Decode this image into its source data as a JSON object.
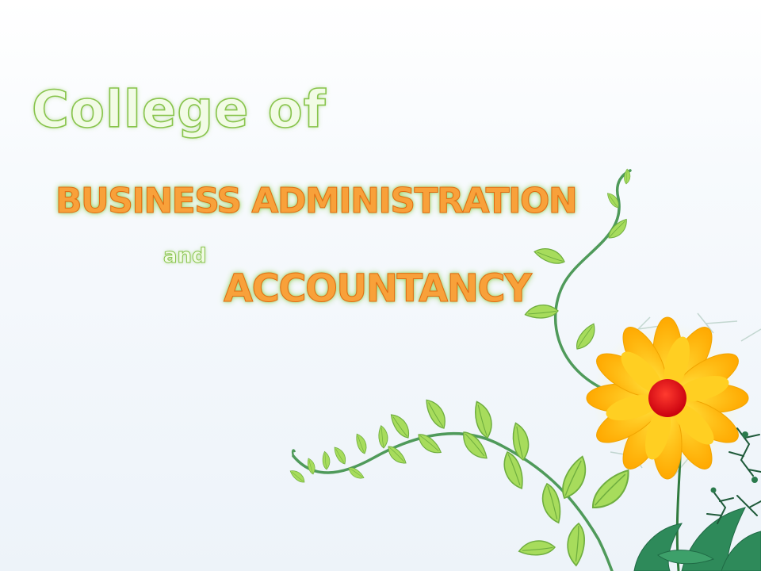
{
  "slide": {
    "title_line1": "College of",
    "title_line2": "BUSINESS ADMINISTRATION",
    "title_and": "and",
    "title_line3": "ACCOUNTANCY"
  },
  "colors": {
    "background_top": "#ffffff",
    "background_bottom": "#edf3f9",
    "green_text_fill": "#f2fbe6",
    "green_outline": "#88c44c",
    "orange_text": "#f8a13a",
    "orange_outline": "#e06a12",
    "leaf_green": "#9fd854",
    "stem_green": "#4f8f5a",
    "petal_yellow": "#ffc21a",
    "flower_center": "#e8141e"
  },
  "decorations": [
    "vine-with-leaves",
    "sunflower",
    "dark-grass-leaves"
  ]
}
